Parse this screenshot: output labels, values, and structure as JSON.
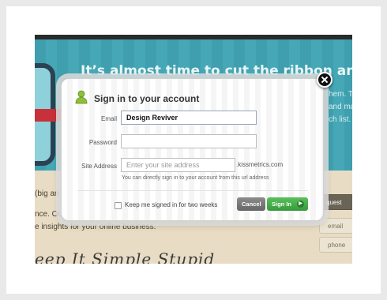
{
  "background": {
    "banner_title": "It’s almost time to cut the ribbon and u",
    "banner_right_lines": [
      "hem. T",
      "and ma",
      "ch list."
    ],
    "lower_text_lines": [
      "(big an",
      "nce. Ou",
      "e insights for your online business."
    ],
    "side_tabs": [
      "quest",
      "email",
      "phone"
    ],
    "handwriting": "eep It Simple Stupid"
  },
  "modal": {
    "icon": "user-icon",
    "title": "Sign in to your account",
    "close_icon": "close-icon",
    "email": {
      "label": "Email",
      "value": "Design Reviver",
      "placeholder": ""
    },
    "password": {
      "label": "Password",
      "value": "",
      "placeholder": ""
    },
    "site_address": {
      "label": "Site Address",
      "value": "",
      "placeholder": "Enter your site address",
      "suffix": ".kissmetrics.com",
      "hint": "You can directly sign in to your account from this url address"
    },
    "remember": {
      "label": "Keep me signed in for two weeks",
      "checked": false
    },
    "buttons": {
      "cancel": "Cancel",
      "signin": "Sign In"
    }
  },
  "colors": {
    "banner_teal": "#3f9fae",
    "signin_green": "#4caf50",
    "cancel_gray": "#777777"
  }
}
